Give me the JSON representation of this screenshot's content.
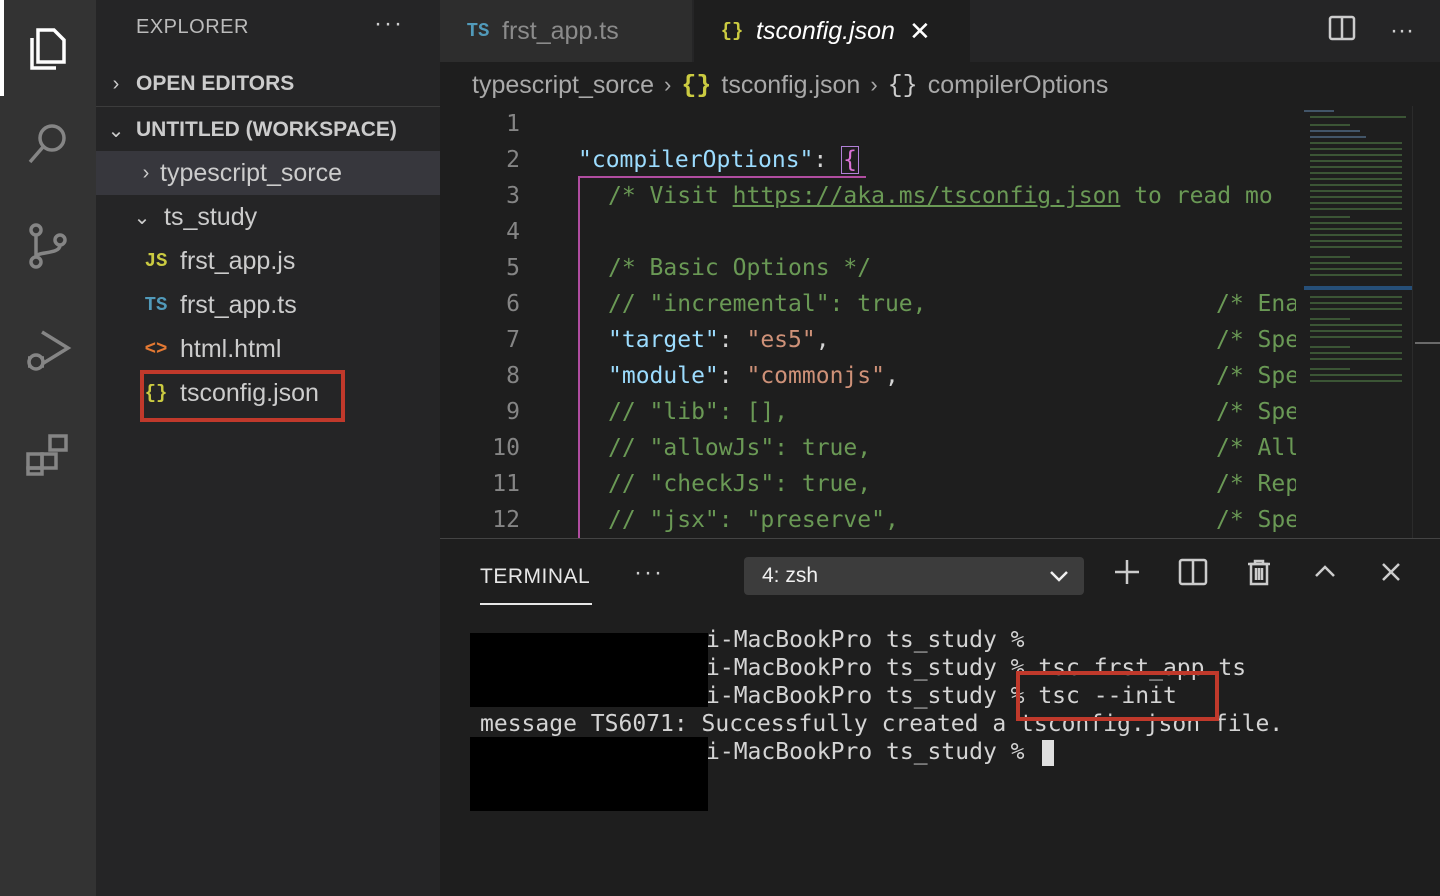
{
  "activity_bar": {
    "items": [
      {
        "name": "explorer-icon",
        "active": true
      },
      {
        "name": "search-icon",
        "active": false
      },
      {
        "name": "source-control-icon",
        "active": false
      },
      {
        "name": "run-debug-icon",
        "active": false
      },
      {
        "name": "extensions-icon",
        "active": false
      }
    ]
  },
  "sidebar": {
    "title": "EXPLORER",
    "more": "···",
    "open_editors": "OPEN EDITORS",
    "workspace": "UNTITLED (WORKSPACE)",
    "tree": [
      {
        "label": "typescript_sorce",
        "type": "folder",
        "expanded": false
      },
      {
        "label": "ts_study",
        "type": "folder",
        "expanded": true
      },
      {
        "label": "frst_app.js",
        "type": "file",
        "icon": "JS"
      },
      {
        "label": "frst_app.ts",
        "type": "file",
        "icon": "TS"
      },
      {
        "label": "html.html",
        "type": "file",
        "icon": "<>"
      },
      {
        "label": "tsconfig.json",
        "type": "file",
        "icon": "{}"
      }
    ]
  },
  "tabs": [
    {
      "icon": "TS",
      "label": "frst_app.ts",
      "active": false
    },
    {
      "icon": "{}",
      "label": "tsconfig.json",
      "active": true,
      "close": "✕"
    }
  ],
  "breadcrumb": {
    "folder": "typescript_sorce",
    "file_icon": "{}",
    "file": "tsconfig.json",
    "symbol_icon": "{}",
    "symbol": "compilerOptions"
  },
  "editor": {
    "line_numbers": [
      "1",
      "2",
      "3",
      "4",
      "5",
      "6",
      "7",
      "8",
      "9",
      "10",
      "11",
      "12"
    ],
    "lines": {
      "l2_key": "\"compilerOptions\"",
      "l2_colon": ": ",
      "l2_brace": "{",
      "l3_a": "/* Visit ",
      "l3_link": "https://aka.ms/tsconfig.json",
      "l3_b": " to read mo",
      "l5": "/* Basic Options */",
      "l6": "// \"incremental\": true,",
      "l6_trail": "/* Ena",
      "l7_key": "\"target\"",
      "l7_val": "\"es5\"",
      "l7_trail": "/* Spe",
      "l8_key": "\"module\"",
      "l8_val": "\"commonjs\"",
      "l8_trail": "/* Spe",
      "l9": "// \"lib\": [],",
      "l9_trail": "/* Spe",
      "l10": "// \"allowJs\": true,",
      "l10_trail": "/* All",
      "l11": "// \"checkJs\": true,",
      "l11_trail": "/* Rep",
      "l12": "// \"jsx\": \"preserve\",",
      "l12_trail": "/* Spe"
    }
  },
  "terminal": {
    "tab": "TERMINAL",
    "more": "···",
    "selected_shell": "4: zsh",
    "lines": [
      "i-MacBookPro ts_study %",
      "i-MacBookPro ts_study % tsc frst_app.ts",
      "i-MacBookPro ts_study % tsc --init",
      "message TS6071: Successfully created a tsconfig.json file.",
      "i-MacBookPro ts_study % "
    ]
  },
  "colors": {
    "highlight_border": "#c0392b",
    "accent_json": "#cbcb41",
    "accent_ts": "#519aba"
  }
}
